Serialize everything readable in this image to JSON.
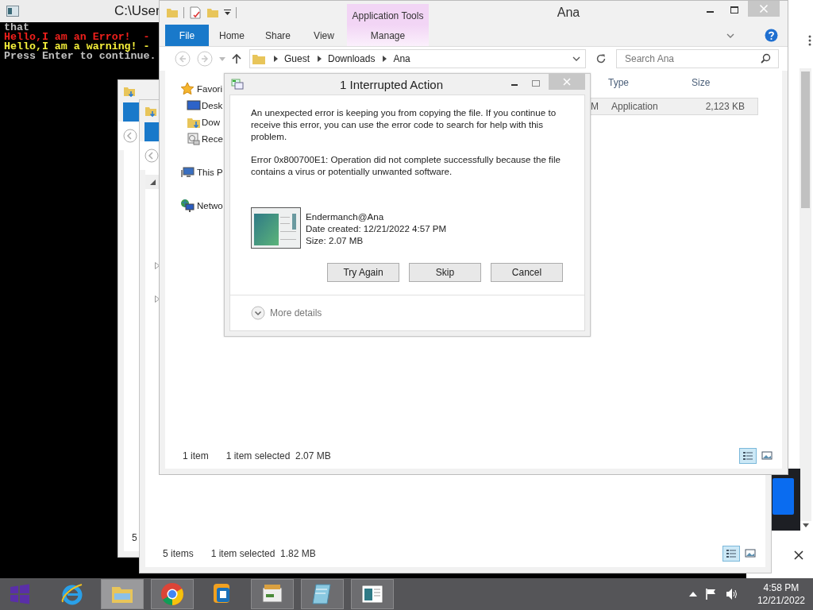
{
  "console": {
    "title": "C:\\User",
    "lines": [
      {
        "kind": "normal",
        "text": "that"
      },
      {
        "kind": "error",
        "text": "Hello,I am an Error!  -"
      },
      {
        "kind": "warning",
        "text": "Hello,I am a warning! -"
      },
      {
        "kind": "normal",
        "text": "Press Enter to continue."
      }
    ]
  },
  "back_windows": [
    {
      "status_count": "5"
    },
    {
      "status_count": "5 items",
      "status_selection": "1 item selected  1.82 MB",
      "view_buttons": [
        {
          "kind": "details",
          "selected": true
        },
        {
          "kind": "thumbnails",
          "selected": false
        }
      ]
    }
  ],
  "explorer": {
    "title": "Ana",
    "contextual_header": "Application Tools",
    "ribbon_tabs": [
      {
        "kind": "file",
        "label": "File"
      },
      {
        "kind": "tab",
        "label": "Home"
      },
      {
        "kind": "tab",
        "label": "Share"
      },
      {
        "kind": "tab",
        "label": "View"
      },
      {
        "kind": "contextual",
        "label": "Manage"
      }
    ],
    "breadcrumb": [
      "Guest",
      "Downloads",
      "Ana"
    ],
    "search": {
      "placeholder": "Search Ana"
    },
    "nav": [
      {
        "kind": "favorites",
        "label": "Favori",
        "children": [
          {
            "kind": "desktop",
            "label": "Desk"
          },
          {
            "kind": "downloads",
            "label": "Dow"
          },
          {
            "kind": "recent",
            "label": "Rece"
          }
        ]
      },
      {
        "kind": "pc",
        "label": "This P"
      },
      {
        "kind": "network",
        "label": "Netwo"
      }
    ],
    "columns": [
      "Type",
      "Size"
    ],
    "rows": [
      {
        "column_1": "M",
        "type": "Application",
        "size": "2,123 KB",
        "selected": true
      }
    ],
    "status_count": "1 item",
    "status_selection": "1 item selected  2.07 MB",
    "view_buttons": [
      {
        "kind": "details",
        "selected": true
      },
      {
        "kind": "thumbnails",
        "selected": false
      }
    ]
  },
  "dialog": {
    "title": "1 Interrupted Action",
    "messages": [
      "An unexpected error is keeping you from copying the file. If you continue to receive this error, you can use the error code to search for help with this problem.",
      "Error 0x800700E1: Operation did not complete successfully because the file contains a virus or potentially unwanted software."
    ],
    "file": {
      "name": "Endermanch@Ana",
      "date": "Date created: 12/21/2022 4:57 PM",
      "size": "Size: 2.07 MB"
    },
    "buttons": [
      "Try Again",
      "Skip",
      "Cancel"
    ],
    "more_details": "More details"
  },
  "taskbar": {
    "apps": [
      {
        "kind": "ie",
        "open": false,
        "selected": false
      },
      {
        "kind": "explorer",
        "open": true,
        "selected": true
      },
      {
        "kind": "chrome",
        "open": true,
        "selected": false
      },
      {
        "kind": "vm",
        "open": false,
        "selected": false
      },
      {
        "kind": "archive",
        "open": true,
        "selected": false
      },
      {
        "kind": "notepad",
        "open": true,
        "selected": false
      },
      {
        "kind": "viewer",
        "open": true,
        "selected": false
      }
    ],
    "time": "4:58 PM",
    "date": "12/21/2022"
  }
}
